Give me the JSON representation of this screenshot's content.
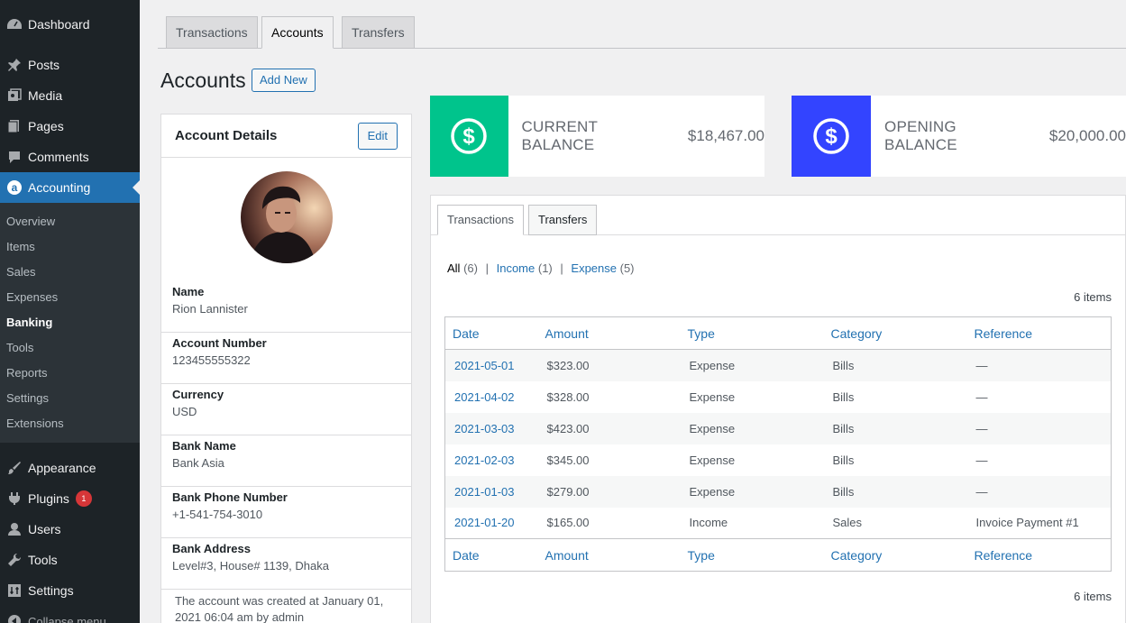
{
  "sidebar": {
    "items": [
      {
        "label": "Dashboard",
        "icon": "dashboard-icon"
      },
      {
        "label": "Posts",
        "icon": "pin-icon"
      },
      {
        "label": "Media",
        "icon": "media-icon"
      },
      {
        "label": "Pages",
        "icon": "pages-icon"
      },
      {
        "label": "Comments",
        "icon": "comment-icon"
      },
      {
        "label": "Accounting",
        "icon": "accounting-icon"
      }
    ],
    "submenu": [
      "Overview",
      "Items",
      "Sales",
      "Expenses",
      "Banking",
      "Tools",
      "Reports",
      "Settings",
      "Extensions"
    ],
    "lower": [
      {
        "label": "Appearance",
        "icon": "brush-icon"
      },
      {
        "label": "Plugins",
        "icon": "plugin-icon",
        "badge": "1"
      },
      {
        "label": "Users",
        "icon": "user-icon"
      },
      {
        "label": "Tools",
        "icon": "wrench-icon"
      },
      {
        "label": "Settings",
        "icon": "settings-icon"
      }
    ],
    "collapse": "Collapse menu"
  },
  "top_tabs": [
    "Transactions",
    "Accounts",
    "Transfers"
  ],
  "page": {
    "title": "Accounts",
    "add_new": "Add New"
  },
  "details": {
    "title": "Account Details",
    "edit": "Edit",
    "fields": [
      {
        "label": "Name",
        "value": "Rion Lannister"
      },
      {
        "label": "Account Number",
        "value": "123455555322"
      },
      {
        "label": "Currency",
        "value": "USD"
      },
      {
        "label": "Bank Name",
        "value": "Bank Asia"
      },
      {
        "label": "Bank Phone Number",
        "value": "+1-541-754-3010"
      },
      {
        "label": "Bank Address",
        "value": "Level#3, House# 1139, Dhaka"
      }
    ],
    "created": "The account was created at January 01, 2021 06:04 am by admin"
  },
  "balances": {
    "current": {
      "label": "CURRENT BALANCE",
      "value": "$18,467.00",
      "color": "#00c48c"
    },
    "opening": {
      "label": "OPENING BALANCE",
      "value": "$20,000.00",
      "color": "#3344ff"
    }
  },
  "panel": {
    "tabs": [
      "Transactions",
      "Transfers"
    ],
    "filters": [
      {
        "label": "All",
        "count": "(6)"
      },
      {
        "label": "Income",
        "count": "(1)"
      },
      {
        "label": "Expense",
        "count": "(5)"
      }
    ],
    "items_count": "6 items",
    "columns": [
      "Date",
      "Amount",
      "Type",
      "Category",
      "Reference"
    ],
    "rows": [
      [
        "2021-05-01",
        "$323.00",
        "Expense",
        "Bills",
        "—"
      ],
      [
        "2021-04-02",
        "$328.00",
        "Expense",
        "Bills",
        "—"
      ],
      [
        "2021-03-03",
        "$423.00",
        "Expense",
        "Bills",
        "—"
      ],
      [
        "2021-02-03",
        "$345.00",
        "Expense",
        "Bills",
        "—"
      ],
      [
        "2021-01-03",
        "$279.00",
        "Expense",
        "Bills",
        "—"
      ],
      [
        "2021-01-20",
        "$165.00",
        "Income",
        "Sales",
        "Invoice Payment #1"
      ]
    ]
  }
}
